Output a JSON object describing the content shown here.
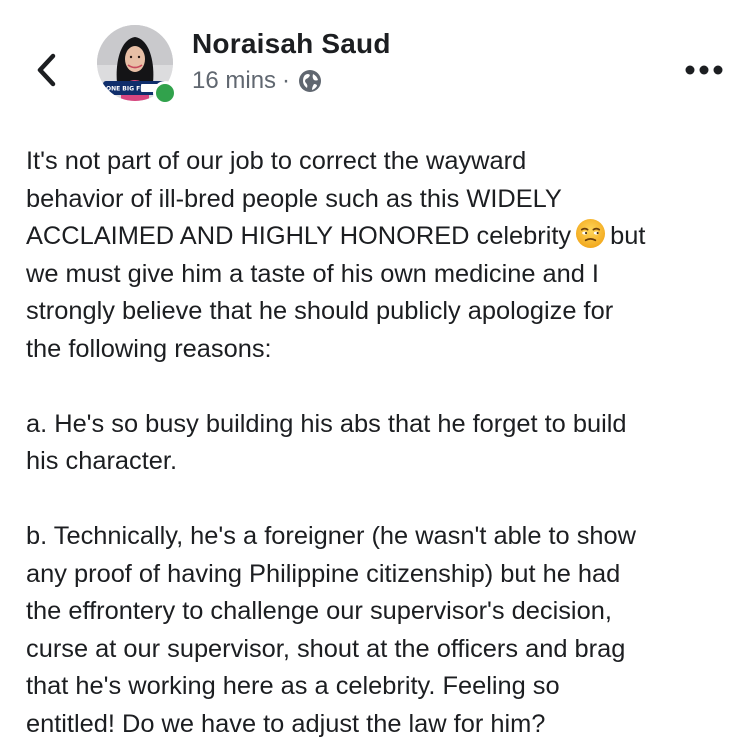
{
  "post": {
    "author": "Noraisah Saud",
    "time": "16 mins",
    "separator": "·",
    "privacy_icon": "globe-icon",
    "back_icon": "chevron-left-icon",
    "more_icon": "more-options-icon",
    "avatar_logo_text": "ONE BIG FIG",
    "online_color": "#31a24c",
    "emoji": "unamused-face",
    "body": {
      "line1": "It's not part of our job to correct the wayward",
      "line2": "behavior of ill-bred people such as this WIDELY",
      "line3a": "ACCLAIMED AND HIGHLY HONORED celebrity",
      "line3b": "but",
      "line4": "we must give him a taste of his own medicine and I",
      "line5": "strongly believe that he should publicly apologize for",
      "line6": "the following reasons:",
      "line7": "a. He's so busy building his abs that he forget to build",
      "line8": "his character.",
      "line9": "b. Technically, he's a foreigner (he wasn't able to show",
      "line10": "any proof of having Philippine citizenship) but he had",
      "line11": "the effrontery to challenge our supervisor's decision,",
      "line12": "curse at our supervisor, shout at the officers and brag",
      "line13": "that he's working here as a celebrity. Feeling so",
      "line14": "entitled! Do we have to adjust the law for him?"
    }
  }
}
